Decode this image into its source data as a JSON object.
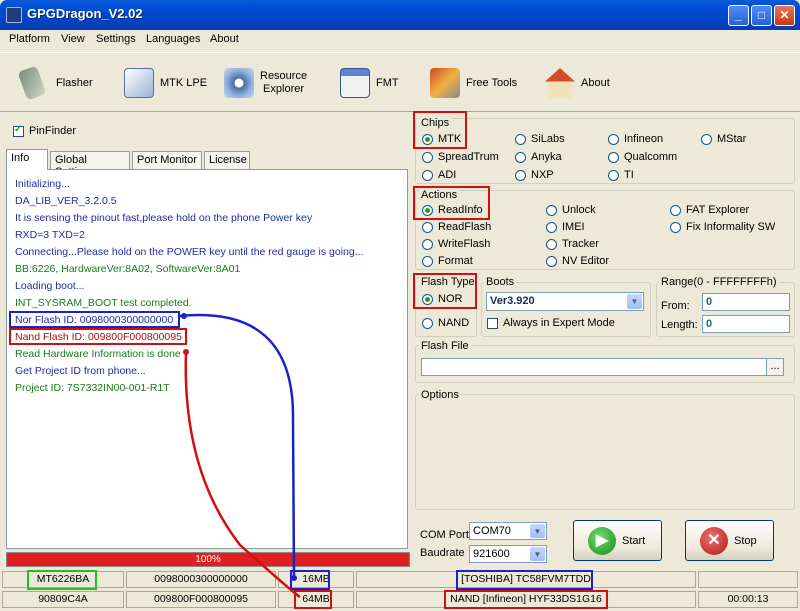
{
  "window": {
    "title": "GPGDragon_V2.02",
    "min": "_",
    "max": "□",
    "close": "✕"
  },
  "menu": [
    "Platform",
    "View",
    "Settings",
    "Languages",
    "About"
  ],
  "toolbar": {
    "flasher": "Flasher",
    "mtk_lpe": "MTK LPE",
    "resource_explorer_1": "Resource",
    "resource_explorer_2": "Explorer",
    "fmt": "FMT",
    "free_tools": "Free Tools",
    "about": "About"
  },
  "pinfinder": {
    "label": "PinFinder",
    "checked": true
  },
  "tabs": [
    "Info",
    "Global Settings",
    "Port Monitor",
    "License"
  ],
  "log": [
    {
      "text": "Initializing...",
      "color": "blue"
    },
    {
      "text": "DA_LIB_VER_3.2.0.5",
      "color": "blue"
    },
    {
      "text": "It is sensing the pinout fast,please hold on the phone Power key",
      "color": "blue"
    },
    {
      "text": "RXD=3  TXD=2",
      "color": "blue"
    },
    {
      "text": "Connecting...Please hold on the POWER key until the red gauge is going...",
      "color": "blue"
    },
    {
      "text": "BB:6226,     HardwareVer:8A02,     SoftwareVer:8A01",
      "color": "green"
    },
    {
      "text": "Loading boot...",
      "color": "blue"
    },
    {
      "text": "INT_SYSRAM_BOOT test completed.",
      "color": "green"
    },
    {
      "text": "Nor Flash ID: 0098000300000000",
      "color": "blue"
    },
    {
      "text": "Nand Flash ID: 009800F000800095",
      "color": "red"
    },
    {
      "text": "Read Hardware Information is done",
      "color": "green"
    },
    {
      "text": "Get Project ID from phone...",
      "color": "blue"
    },
    {
      "text": "Project ID: 7S7332IN00-001-R1T",
      "color": "green"
    }
  ],
  "progress": {
    "label": "100%",
    "value": 1.0
  },
  "status_row1": {
    "chip": "MT6226BA",
    "nor_id": "0098000300000000",
    "nor_size": "16MB",
    "nor_model": "[TOSHIBA] TC58FVM7TDD"
  },
  "status_row2": {
    "hw": "90809C4A",
    "nand_id": "009800F000800095",
    "nand_size": "64MB",
    "nand_model": "NAND  [Infineon] HYF33DS1G16",
    "time": "00:00:13"
  },
  "chips": {
    "label": "Chips",
    "options": [
      "MTK",
      "SiLabs",
      "Infineon",
      "MStar",
      "SpreadTrum",
      "Anyka",
      "Qualcomm",
      "ADI",
      "NXP",
      "TI"
    ],
    "selected": "MTK"
  },
  "actions": {
    "label": "Actions",
    "options": [
      "ReadInfo",
      "Unlock",
      "FAT Explorer",
      "ReadFlash",
      "IMEI",
      "Fix Informality SW",
      "WriteFlash",
      "Tracker",
      "Format",
      "NV Editor"
    ],
    "selected": "ReadInfo"
  },
  "flash_type": {
    "label": "Flash Type",
    "nor": "NOR",
    "nand": "NAND",
    "selected": "NOR"
  },
  "boots": {
    "label": "Boots",
    "value": "Ver3.920",
    "expert": "Always in Expert Mode"
  },
  "range": {
    "label": "Range(0 - FFFFFFFFh)",
    "from_label": "From:",
    "from": "0",
    "length_label": "Length:",
    "length": "0"
  },
  "flash_file": {
    "label": "Flash File",
    "browse": "..."
  },
  "options": {
    "label": "Options"
  },
  "com": {
    "port_label": "COM Port",
    "port": "COM70",
    "baud_label": "Baudrate",
    "baud": "921600"
  },
  "buttons": {
    "start": "Start",
    "stop": "Stop"
  },
  "colors": {
    "accent_red": "#d01010",
    "accent_blue": "#1a22c8",
    "accent_green": "#21c021",
    "progress": "#e02020"
  }
}
